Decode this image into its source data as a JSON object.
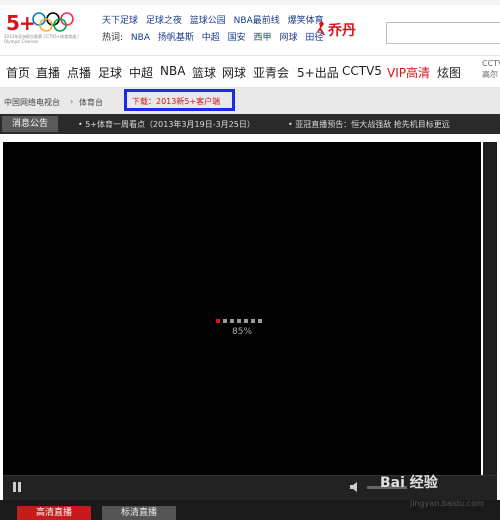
{
  "header": {
    "logo_text": "5+",
    "logo_caption": "2013年亚洲职业联赛 CCTV5+体育频道 / Olympic Channel",
    "headline_row1": [
      "天下足球",
      "足球之夜",
      "篮球公园",
      "NBA最前线",
      "爆笑体育"
    ],
    "hot_label": "热词:",
    "headline_row2": [
      "NBA",
      "扬帆基斯",
      "中超",
      "国安",
      "西甲",
      "网球",
      "田径"
    ],
    "brand": "乔丹"
  },
  "nav": {
    "items": [
      "首页",
      "直播",
      "点播",
      "足球",
      "中超",
      "NBA",
      "篮球",
      "网球",
      "亚青会",
      "5+出品",
      "CCTV5",
      "VIP高清",
      "炫图"
    ],
    "right_line1": "CCTV",
    "right_line2": "高尔"
  },
  "breadcrumb": {
    "site": "中国网络电视台",
    "arrow": "›",
    "section": "体育台",
    "download": "下载：2013新5+客户端"
  },
  "notice": {
    "label": "消息公告",
    "item1": "• 5+体育一周看点（2013年3月19日-3月25日）",
    "item2": "• 亚冠直播预告：恒大战强敌  抢先机目标更远"
  },
  "player": {
    "loading_percent": "85%",
    "loading_fraction": 0.85
  },
  "watermark": {
    "logo": "Bai 经验",
    "url": "jingyan.baidu.com"
  },
  "buttons": {
    "hd": "高清直播",
    "sd": "标清直播"
  },
  "colors": {
    "brand_red": "#d4141a",
    "link_blue": "#1a3d8f",
    "highlight_box": "#1a2ce6"
  }
}
